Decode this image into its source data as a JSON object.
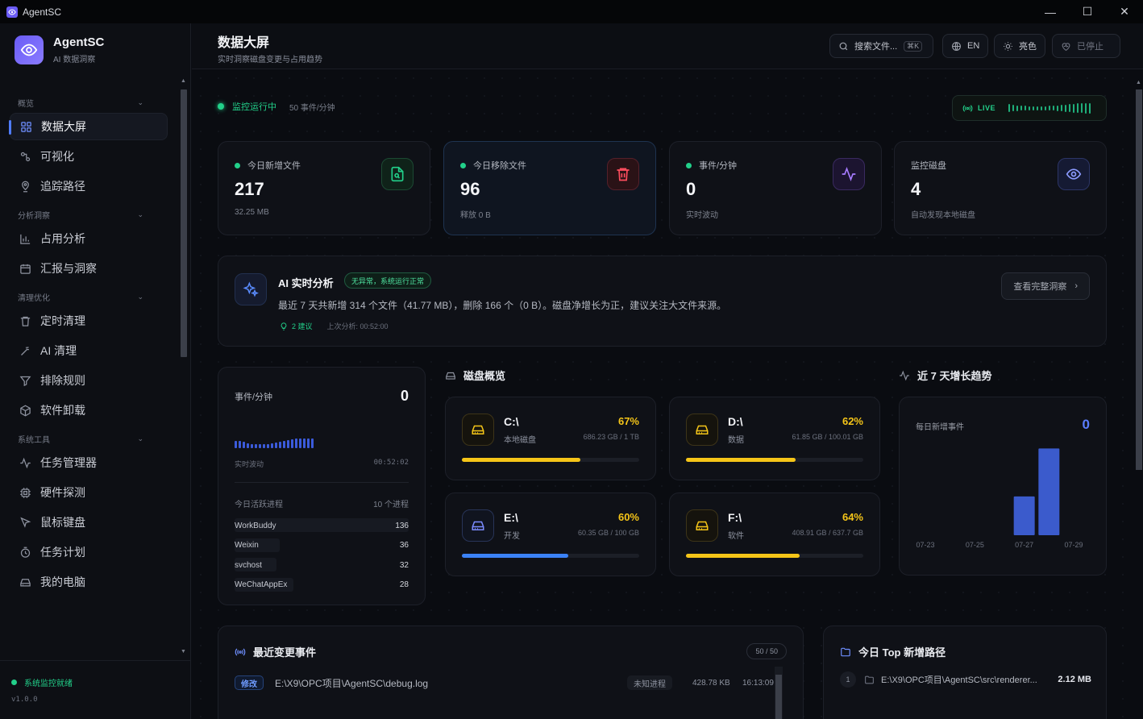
{
  "window": {
    "title": "AgentSC",
    "minimize": "—",
    "maximize": "☐",
    "close": "✕"
  },
  "brand": {
    "name": "AgentSC",
    "subtitle": "AI 数据洞察"
  },
  "nav": {
    "sections": [
      {
        "label": "概览",
        "items": [
          {
            "label": "数据大屏",
            "icon": "dashboard-icon",
            "active": true
          },
          {
            "label": "可视化",
            "icon": "visual-icon"
          },
          {
            "label": "追踪路径",
            "icon": "track-icon"
          }
        ]
      },
      {
        "label": "分析洞察",
        "items": [
          {
            "label": "占用分析",
            "icon": "chart-icon"
          },
          {
            "label": "汇报与洞察",
            "icon": "calendar-icon"
          }
        ]
      },
      {
        "label": "清理优化",
        "items": [
          {
            "label": "定时清理",
            "icon": "trash-icon"
          },
          {
            "label": "AI 清理",
            "icon": "wand-icon"
          },
          {
            "label": "排除规则",
            "icon": "filter-icon"
          },
          {
            "label": "软件卸载",
            "icon": "package-icon"
          }
        ]
      },
      {
        "label": "系统工具",
        "items": [
          {
            "label": "任务管理器",
            "icon": "activity-icon"
          },
          {
            "label": "硬件探测",
            "icon": "cpu-icon"
          },
          {
            "label": "鼠标键盘",
            "icon": "pointer-icon"
          },
          {
            "label": "任务计划",
            "icon": "clock-icon"
          },
          {
            "label": "我的电脑",
            "icon": "drive-icon"
          }
        ]
      }
    ]
  },
  "sidebar_footer": {
    "status": "系统监控就绪",
    "version": "v1.0.0"
  },
  "header": {
    "title": "数据大屏",
    "subtitle": "实时洞察磁盘变更与占用趋势",
    "search_label": "搜索文件...",
    "search_kbd": "⌘K",
    "lang": "EN",
    "theme": "亮色",
    "stop": "已停止"
  },
  "monitor": {
    "status": "监控运行中",
    "rate": "50 事件/分钟",
    "live": "LIVE"
  },
  "stats": [
    {
      "label": "今日新增文件",
      "value": "217",
      "sub": "32.25 MB",
      "color": "#22d08a"
    },
    {
      "label": "今日移除文件",
      "value": "96",
      "sub": "释放 0 B",
      "color": "#ff4d5e"
    },
    {
      "label": "事件/分钟",
      "value": "0",
      "sub": "实时波动",
      "color": "#a67bff"
    },
    {
      "label": "监控磁盘",
      "value": "4",
      "sub": "自动发现本地磁盘",
      "color": "#7b8bff"
    }
  ],
  "ai": {
    "title": "AI 实时分析",
    "badge": "无异常，系统运行正常",
    "text": "最近 7 天共新增 314 个文件（41.77 MB），删除 166 个（0 B）。磁盘净增长为正，建议关注大文件来源。",
    "suggestions": "2 建议",
    "last": "上次分析: 00:52:00",
    "button": "查看完整洞察"
  },
  "events": {
    "title": "事件/分钟",
    "value": "0",
    "wave": "实时波动",
    "time": "00:52:02",
    "proc_title": "今日活跃进程",
    "proc_count": "10 个进程",
    "processes": [
      {
        "name": "WorkBuddy",
        "count": "136",
        "share": 1.0
      },
      {
        "name": "Weixin",
        "count": "36",
        "share": 0.26
      },
      {
        "name": "svchost",
        "count": "32",
        "share": 0.24
      },
      {
        "name": "WeChatAppEx",
        "count": "28",
        "share": 0.34
      }
    ]
  },
  "disk_overview": {
    "title": "磁盘概览"
  },
  "disks": [
    {
      "name": "C:\\",
      "type": "本地磁盘",
      "pct": "67%",
      "size": "686.23 GB / 1 TB",
      "fill": 0.67,
      "color": "#f5c518"
    },
    {
      "name": "D:\\",
      "type": "数据",
      "pct": "62%",
      "size": "61.85 GB / 100.01 GB",
      "fill": 0.62,
      "color": "#f5c518"
    },
    {
      "name": "E:\\",
      "type": "开发",
      "pct": "60%",
      "size": "60.35 GB / 100 GB",
      "fill": 0.6,
      "color": "#3b82f6"
    },
    {
      "name": "F:\\",
      "type": "软件",
      "pct": "64%",
      "size": "408.91 GB / 637.7 GB",
      "fill": 0.64,
      "color": "#f5c518"
    }
  ],
  "trend": {
    "title": "近 7 天增长趋势",
    "label": "每日新增事件",
    "value": "0"
  },
  "chart_data": {
    "type": "bar",
    "categories": [
      "07-23",
      "07-24",
      "07-25",
      "07-26",
      "07-27",
      "07-28",
      "07-29"
    ],
    "tick_labels": [
      "07-23",
      "07-25",
      "07-27",
      "07-29"
    ],
    "values": [
      0,
      0,
      0,
      0,
      97,
      217,
      0
    ],
    "title": "每日新增事件",
    "ylim": [
      0,
      240
    ],
    "color": "#3b5bcc"
  },
  "recent": {
    "title": "最近变更事件",
    "count": "50 / 50",
    "rows": [
      {
        "tag": "修改",
        "path": "E:\\X9\\OPC项目\\AgentSC\\debug.log",
        "proc": "未知进程",
        "size": "428.78 KB",
        "time": "16:13:09"
      }
    ]
  },
  "top_paths": {
    "title": "今日 Top 新增路径",
    "rows": [
      {
        "rank": "1",
        "path": "E:\\X9\\OPC项目\\AgentSC\\src\\renderer...",
        "size": "2.12 MB"
      }
    ]
  }
}
